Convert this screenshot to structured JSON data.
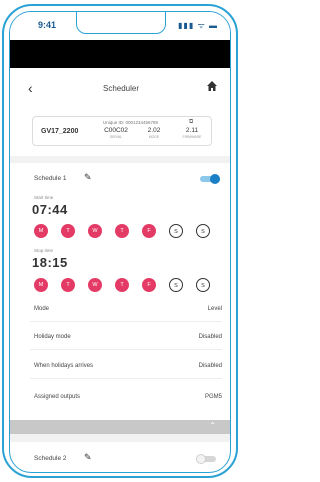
{
  "status_bar": {
    "time": "9:41",
    "icons": "▮▮▮ ᯤ ▬"
  },
  "header": {
    "title": "Scheduler",
    "back_icon": "chevron-left-icon",
    "home_icon": "home-icon"
  },
  "device": {
    "name": "GV17_2200",
    "unique_id": "Unique ID: 0001234456789",
    "stats": [
      {
        "value": "C00C02",
        "label": "SERIAL"
      },
      {
        "value": "2.02",
        "label": "MODE"
      },
      {
        "value": "2.11",
        "label": "FIRMWARE"
      }
    ]
  },
  "schedule1": {
    "title": "Schedule 1",
    "enabled": true,
    "start_label": "Start time",
    "start_time": "07:44",
    "start_days": [
      {
        "letter": "M",
        "active": true
      },
      {
        "letter": "T",
        "active": true
      },
      {
        "letter": "W",
        "active": true
      },
      {
        "letter": "T",
        "active": true
      },
      {
        "letter": "F",
        "active": true
      },
      {
        "letter": "S",
        "active": false
      },
      {
        "letter": "S",
        "active": false
      }
    ],
    "stop_label": "Stop time",
    "stop_time": "18:15",
    "stop_days": [
      {
        "letter": "M",
        "active": true
      },
      {
        "letter": "T",
        "active": true
      },
      {
        "letter": "W",
        "active": true
      },
      {
        "letter": "T",
        "active": true
      },
      {
        "letter": "F",
        "active": true
      },
      {
        "letter": "S",
        "active": false
      },
      {
        "letter": "S",
        "active": false
      }
    ],
    "settings": [
      {
        "key": "Mode",
        "value": "Level"
      },
      {
        "key": "Holiday mode",
        "value": "Disabled"
      },
      {
        "key": "When holidays arrives",
        "value": "Disabled"
      },
      {
        "key": "Assigned outputs",
        "value": "PGM5"
      }
    ]
  },
  "schedule2": {
    "title": "Schedule 2",
    "enabled": false
  },
  "colors": {
    "accent": "#2aa2d4",
    "day_active": "#e43b66",
    "toggle_on": "#1a7fc4"
  }
}
